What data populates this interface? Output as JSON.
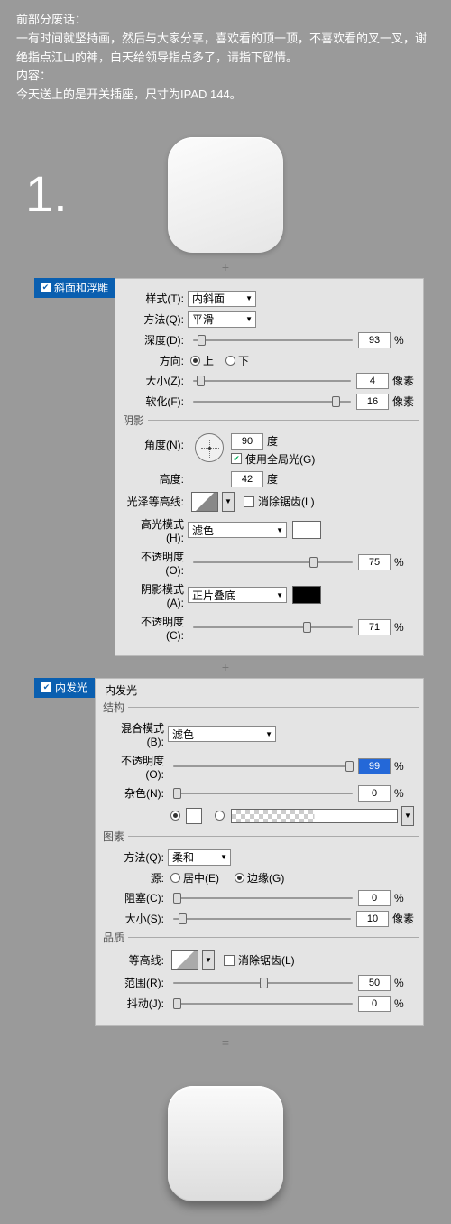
{
  "intro": {
    "title": "前部分废话：",
    "body": "一有时间就坚持画，然后与大家分享，喜欢看的顶一顶，不喜欢看的叉一叉，谢绝指点江山的神，白天给领导指点多了，请指下留情。",
    "content_label": "内容：",
    "content_body": "今天送上的是开关插座，尺寸为IPAD 144。"
  },
  "step": "1.",
  "plus": "+",
  "eq": "=",
  "bevel": {
    "tab": "斜面和浮雕",
    "style_label": "样式(T):",
    "style_value": "内斜面",
    "technique_label": "方法(Q):",
    "technique_value": "平滑",
    "depth_label": "深度(D):",
    "depth_value": "93",
    "direction_label": "方向:",
    "up": "上",
    "down": "下",
    "size_label": "大小(Z):",
    "size_value": "4",
    "soften_label": "软化(F):",
    "soften_value": "16",
    "px": "像素",
    "pct": "%",
    "shadow_cat": "阴影",
    "angle_label": "角度(N):",
    "angle_value": "90",
    "degree": "度",
    "global_light": "使用全局光(G)",
    "altitude_label": "高度:",
    "altitude_value": "42",
    "gloss_label": "光泽等高线:",
    "antialias": "消除锯齿(L)",
    "highlight_mode_label": "高光模式(H):",
    "highlight_mode_value": "滤色",
    "opacity_label": "不透明度(O):",
    "highlight_opacity": "75",
    "shadow_mode_label": "阴影模式(A):",
    "shadow_mode_value": "正片叠底",
    "opacity_c_label": "不透明度(C):",
    "shadow_opacity": "71"
  },
  "glow": {
    "tab": "内发光",
    "header": "内发光",
    "structure_cat": "结构",
    "blend_label": "混合模式(B):",
    "blend_value": "滤色",
    "opacity_label": "不透明度(O):",
    "opacity_value": "99",
    "noise_label": "杂色(N):",
    "noise_value": "0",
    "pct": "%",
    "elements_cat": "图素",
    "method_label": "方法(Q):",
    "method_value": "柔和",
    "source_label": "源:",
    "center": "居中(E)",
    "edge": "边缘(G)",
    "choke_label": "阻塞(C):",
    "choke_value": "0",
    "size_label": "大小(S):",
    "size_value": "10",
    "px": "像素",
    "quality_cat": "品质",
    "contour_label": "等高线:",
    "antialias": "消除锯齿(L)",
    "range_label": "范围(R):",
    "range_value": "50",
    "jitter_label": "抖动(J):",
    "jitter_value": "0"
  }
}
